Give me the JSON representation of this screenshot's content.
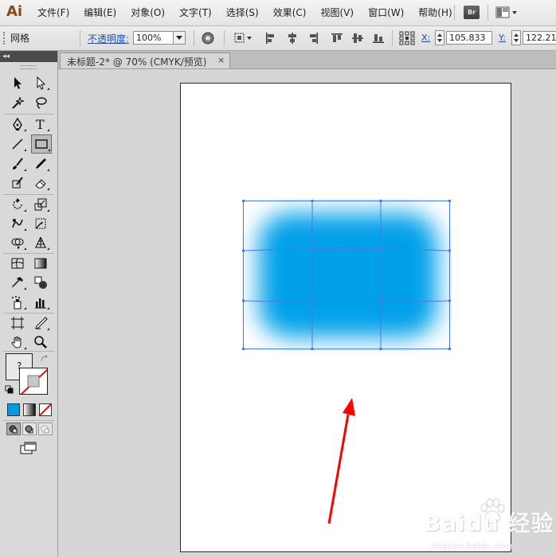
{
  "app": {
    "logo": "Ai"
  },
  "menu": [
    "文件(F)",
    "编辑(E)",
    "对象(O)",
    "文字(T)",
    "选择(S)",
    "效果(C)",
    "视图(V)",
    "窗口(W)",
    "帮助(H)"
  ],
  "menubar_buttons": {
    "bridge": "Br",
    "workspace_icon": "workspace-switcher-icon"
  },
  "control_bar": {
    "selection_type": "网格",
    "opacity_label": "不透明度:",
    "opacity_value": "100%",
    "x_label": "X:",
    "x_value": "105.833",
    "y_label": "Y:",
    "y_value": "122.21"
  },
  "document": {
    "tab_title": "未标题-2* @ 70% (CMYK/预览)",
    "tab_close": "×"
  },
  "colors": {
    "mesh_fill": "#00a0e9",
    "mesh_lines": "#4a78e6",
    "arrow": "#ff0000",
    "fill_swatch_active": "#0099dd"
  },
  "toolbox": {
    "fill_unknown": "?",
    "tools": [
      "selection-tool",
      "direct-selection-tool",
      "magic-wand-tool",
      "lasso-tool",
      "pen-tool",
      "type-tool",
      "line-segment-tool",
      "rectangle-tool",
      "paintbrush-tool",
      "pencil-tool",
      "blob-brush-tool",
      "eraser-tool",
      "rotate-tool",
      "scale-tool",
      "warp-tool",
      "free-transform-tool",
      "shape-builder-tool",
      "perspective-grid-tool",
      "mesh-tool",
      "gradient-tool",
      "eyedropper-tool",
      "blend-tool",
      "symbol-sprayer-tool",
      "column-graph-tool",
      "artboard-tool",
      "slice-tool",
      "hand-tool",
      "zoom-tool"
    ]
  },
  "watermark": {
    "text": "Baidu 经验",
    "url": "jingyan.baidu.com"
  }
}
